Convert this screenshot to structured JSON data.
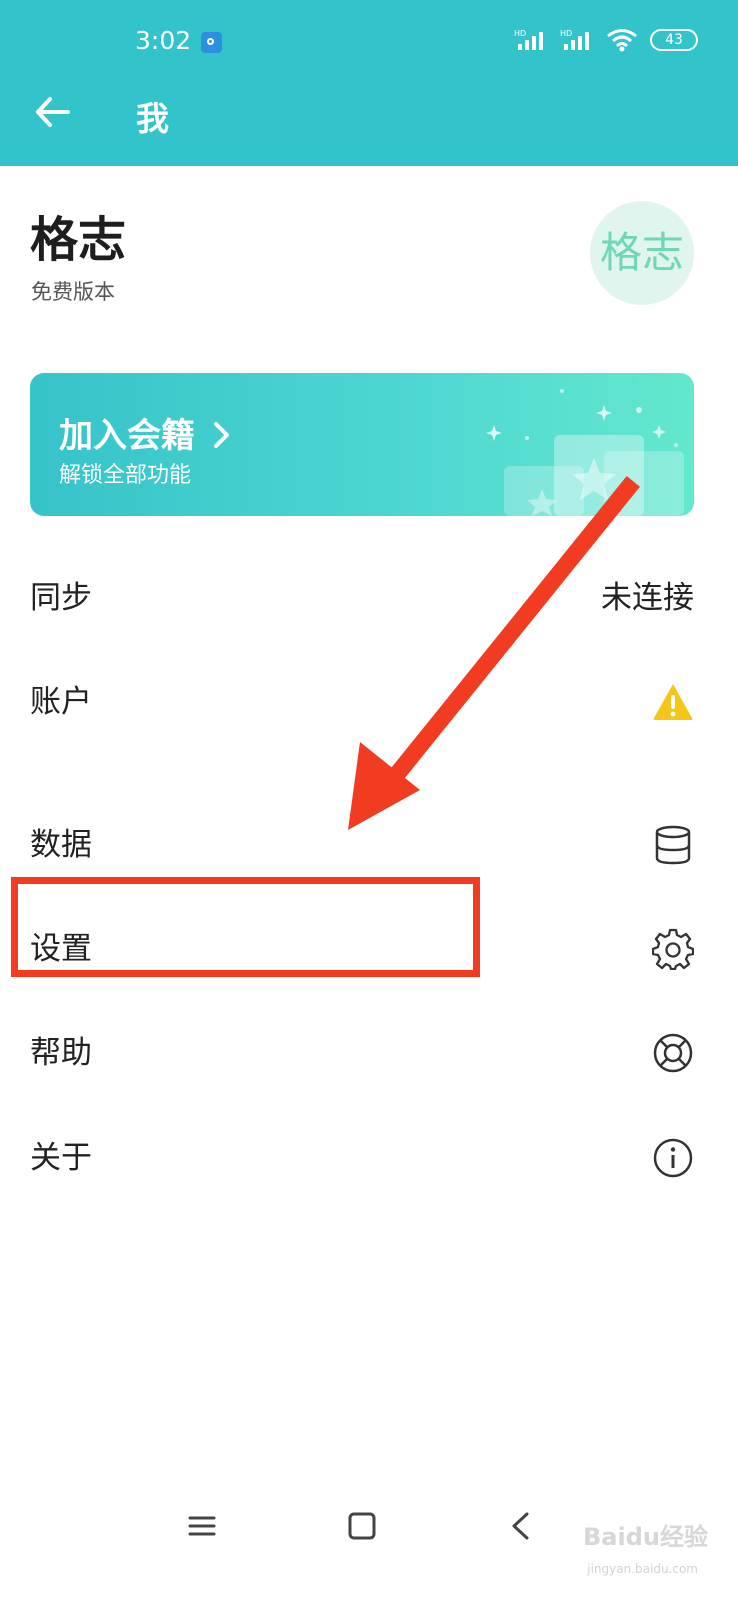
{
  "status_bar": {
    "time": "3:02",
    "battery": "43",
    "signal1_label": "HD",
    "signal2_label": "HD"
  },
  "header": {
    "title": "我"
  },
  "profile": {
    "name": "格志",
    "plan": "免费版本",
    "avatar_text": "格志"
  },
  "membership": {
    "title": "加入会籍",
    "subtitle": "解锁全部功能"
  },
  "menu": {
    "sync_label": "同步",
    "sync_value": "未连接",
    "account_label": "账户",
    "data_label": "数据",
    "settings_label": "设置",
    "help_label": "帮助",
    "about_label": "关于"
  },
  "watermark": {
    "main": "Baidu经验",
    "sub": "jingyan.baidu.com"
  },
  "colors": {
    "header_bg": "#33c4cb",
    "annotation": "#f23c22",
    "warning": "#f5c518"
  },
  "icons": {
    "back": "arrow-left-icon",
    "account_status": "warning-icon",
    "data": "database-icon",
    "settings": "gear-icon",
    "help": "lifebuoy-icon",
    "about": "info-icon"
  }
}
